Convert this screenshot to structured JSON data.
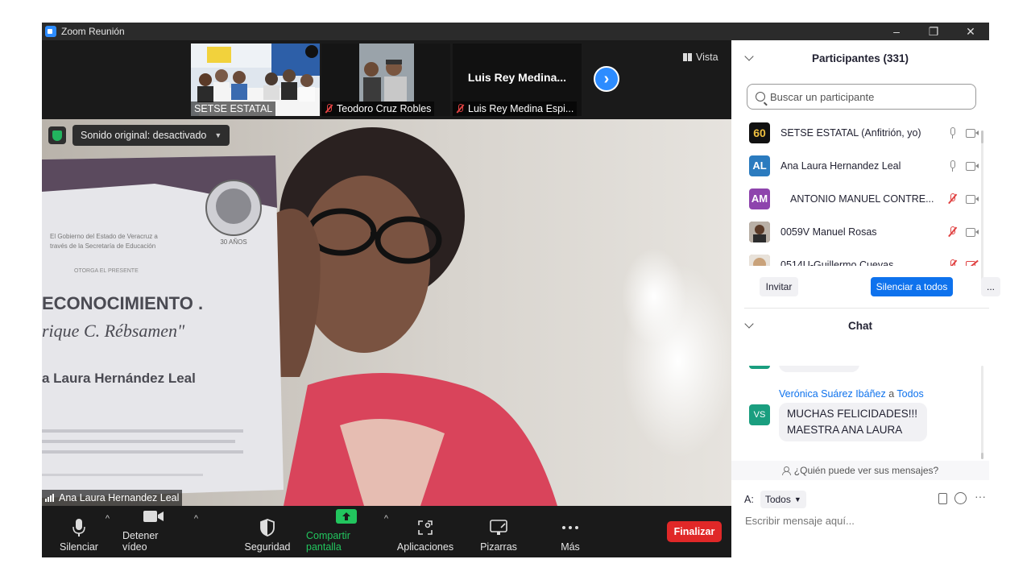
{
  "window": {
    "title": "Zoom Reunión",
    "controls": [
      "–",
      "❐",
      "✕"
    ]
  },
  "strip": {
    "thumbnails": [
      {
        "name": "SETSE ESTATAL",
        "muted": false
      },
      {
        "name": "Teodoro Cruz Robles",
        "muted": true
      },
      {
        "name": "Luis Rey Medina Espi...",
        "big_label": "Luis Rey Medina...",
        "muted": true
      }
    ],
    "next_arrow": "›",
    "view_label": "Vista"
  },
  "main_video": {
    "sound_label": "Sonido original: desactivado",
    "speaker_name": "Ana Laura Hernandez Leal",
    "certificate": {
      "lines": [
        "El Gobierno del Estado de Veracruz a",
        "través de la Secretaría de Educación",
        "OTORGA EL PRESENTE",
        "ECONOCIMIENTO .",
        "rique C. Rébsamen\"",
        "a Laura Hernández Leal"
      ],
      "seal": "30 AÑOS"
    }
  },
  "toolbar": {
    "buttons": [
      {
        "label": "Silenciar",
        "icon": "microphone-icon"
      },
      {
        "label": "Detener vídeo",
        "icon": "video-camera-icon"
      },
      {
        "label": "Seguridad",
        "icon": "shield-icon"
      },
      {
        "label": "Compartir pantalla",
        "icon": "share-screen-icon"
      },
      {
        "label": "Aplicaciones",
        "icon": "apps-icon"
      },
      {
        "label": "Pizarras",
        "icon": "whiteboard-icon"
      },
      {
        "label": "Más",
        "icon": "more-icon"
      }
    ],
    "caret": "^",
    "end_label": "Finalizar"
  },
  "participants": {
    "header": "Participantes (331)",
    "search_placeholder": "Buscar un participante",
    "list": [
      {
        "name": "SETSE ESTATAL (Anfitrión, yo)",
        "avatar": "60",
        "avatar_color": "#111111",
        "mic": "on",
        "cam": "on"
      },
      {
        "name": "Ana Laura Hernandez Leal",
        "avatar": "AL",
        "avatar_color": "#2b7bbf",
        "mic": "on",
        "cam": "on"
      },
      {
        "name": "ANTONIO MANUEL CONTRE...",
        "avatar": "AM",
        "avatar_color": "#8e44ad",
        "mic": "off",
        "cam": "on"
      },
      {
        "name": "0059V Manuel Rosas",
        "avatar": "",
        "avatar_color": "#6b4e3d",
        "mic": "off",
        "cam": "on"
      },
      {
        "name": "0514U-Guillermo Cuevas",
        "avatar": "",
        "avatar_color": "#c9a27a",
        "mic": "off",
        "cam": "off"
      }
    ],
    "invite_label": "Invitar",
    "mute_all_label": "Silenciar a todos",
    "more_label": "..."
  },
  "chat": {
    "header": "Chat",
    "messages": [
      {
        "sender": "Verónica Suárez Ibáñez",
        "to_word": "a",
        "recipient": "Todos",
        "avatar": "VS",
        "avatar_color": "#1a9e7f",
        "text_lines": [
          "MUCHAS FELICIDADES!!!",
          "MAESTRA ANA LAURA"
        ]
      }
    ],
    "who_can_see": "¿Quién puede ver sus mensajes?",
    "to_label": "A:",
    "to_value": "Todos",
    "input_placeholder": "Escribir mensaje aquí..."
  }
}
